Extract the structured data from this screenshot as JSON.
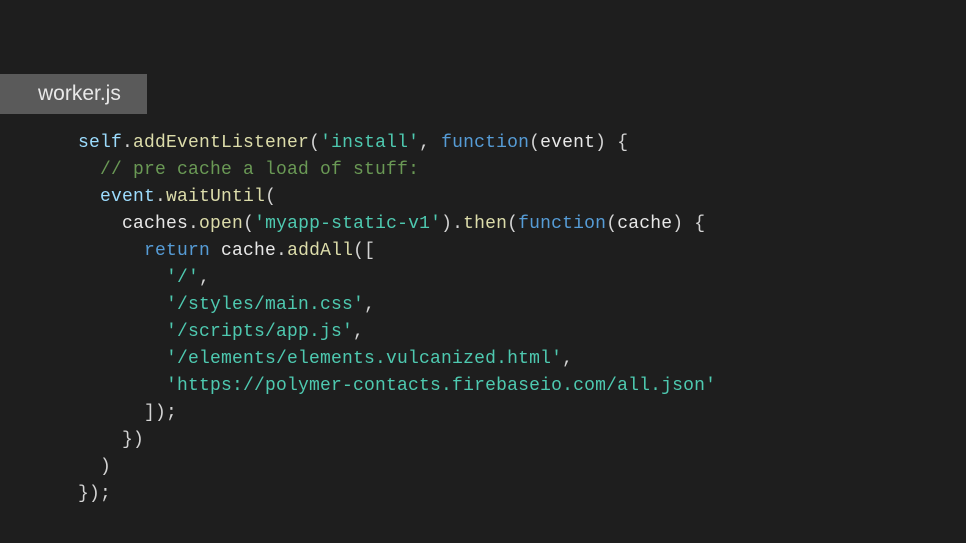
{
  "tab": {
    "filename": "worker.js"
  },
  "code": {
    "self": "self",
    "dot": ".",
    "addEventListener": "addEventListener",
    "open_p": "(",
    "close_p": ")",
    "install_str": "'install'",
    "comma": ", ",
    "function_kw": "function",
    "event_param": "event",
    "brace_o": " {",
    "comment": "// pre cache a load of stuff:",
    "event_obj": "event",
    "waitUntil": "waitUntil",
    "caches": "caches",
    "open_m": "open",
    "myapp_str": "'myapp-static-v1'",
    "then": "then",
    "cache_param": "cache",
    "return_kw": "return",
    "cache_obj": " cache",
    "addAll": "addAll",
    "bracket_o": "([",
    "root_str": "'/'",
    "styles_str": "'/styles/main.css'",
    "scripts_str": "'/scripts/app.js'",
    "elements_str": "'/elements/elements.vulcanized.html'",
    "firebase_str": "'https://polymer-contacts.firebaseio.com/all.json'",
    "bracket_c": "]);",
    "close_brace_p": "})",
    "close_p_only": ")",
    "close_final": "});",
    "indent1": "  ",
    "indent2": "    ",
    "indent3": "      ",
    "indent4": "        ",
    "comma_only": ","
  }
}
